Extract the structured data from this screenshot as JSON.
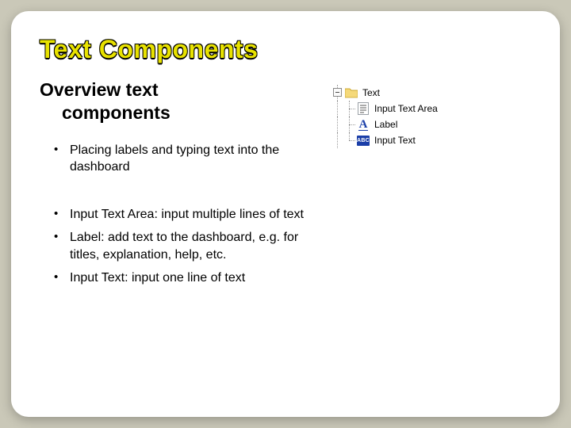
{
  "title": "Text Components",
  "subtitle_line1": "Overview text",
  "subtitle_line2": "components",
  "bullets": {
    "b1": "Placing labels and typing text into the dashboard",
    "b2": "Input Text Area: input multiple lines of text",
    "b3": "Label: add text to the dashboard, e.g. for titles, explanation, help, etc.",
    "b4": "Input Text: input one line of text"
  },
  "tree": {
    "root": "Text",
    "items": {
      "i0": "Input Text Area",
      "i1": "Label",
      "i2": "Input Text"
    }
  }
}
